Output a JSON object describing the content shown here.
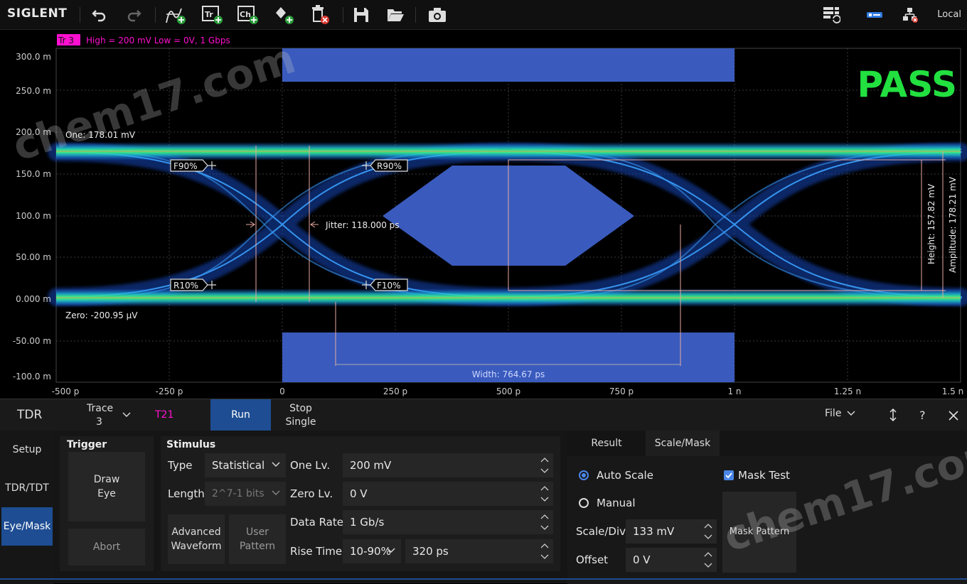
{
  "toolbar": {
    "logo": "SIGLENT",
    "local": "Local",
    "icons": [
      "undo-icon",
      "redo-icon",
      "add-math-icon",
      "add-trace-icon",
      "add-channel-icon",
      "add-marker-icon",
      "delete-icon",
      "save-icon",
      "open-folder-icon",
      "camera-icon",
      "layout-icon",
      "usb-icon",
      "network-icon"
    ]
  },
  "scope": {
    "trace_tag": "Tr 3",
    "trace_info": "High = 200 mV  Low = 0V, 1 Gbps",
    "pass_text": "PASS",
    "y_ticks": [
      "300.0 m",
      "250.0 m",
      "200.0 m",
      "150.0 m",
      "100.0 m",
      "50.00 m",
      "0.000 m",
      "-50.00 m",
      "-100.0 m"
    ],
    "x_ticks": [
      "-500 p",
      "-250 p",
      "0",
      "250 p",
      "500 p",
      "750 p",
      "1 n",
      "1.25 n",
      "1.5 n"
    ],
    "one_label": "One: 178.01 mV",
    "zero_label": "Zero: -200.95 µV",
    "jitter_label": "Jitter: 118.000 ps",
    "width_label": "Width: 764.67 ps",
    "height_label": "Height: 157.82 mV",
    "amplitude_label": "Amplitude: 178.21 mV",
    "markers": {
      "f90": "F90%",
      "r90": "R90%",
      "r10": "R10%",
      "f10": "F10%"
    }
  },
  "panel": {
    "title": "TDR",
    "trace_label": "Trace",
    "trace_value": "3",
    "t21": "T21",
    "run": "Run",
    "stop": "Stop",
    "single": "Single",
    "file": "File",
    "help": "?",
    "sidebar": [
      "Setup",
      "TDR/TDT",
      "Eye/Mask"
    ],
    "trigger": {
      "title": "Trigger",
      "draw": "Draw",
      "eye": "Eye",
      "abort": "Abort"
    },
    "stimulus": {
      "title": "Stimulus",
      "type_label": "Type",
      "type_value": "Statistical",
      "length_label": "Length",
      "length_value": "2^7-1 bits",
      "advanced": "Advanced",
      "waveform": "Waveform",
      "user": "User",
      "pattern": "Pattern",
      "one_label": "One Lv.",
      "one_value": "200 mV",
      "zero_label": "Zero Lv.",
      "zero_value": "0 V",
      "rate_label": "Data Rate",
      "rate_value": "1 Gb/s",
      "rise_label": "Rise Time",
      "rise_mode": "10-90%",
      "rise_value": "320 ps"
    },
    "right": {
      "tab_result": "Result",
      "tab_scale": "Scale/Mask",
      "auto": "Auto Scale",
      "manual": "Manual",
      "scale_label": "Scale/Div",
      "scale_value": "133 mV",
      "offset_label": "Offset",
      "offset_value": "0 V",
      "mask_test": "Mask Test",
      "mask_pattern": "Mask Pattern"
    }
  },
  "watermark": "chem17.com",
  "colors": {
    "pass": "#22e040",
    "trace_tag": "#ff10d0",
    "mask": "#3a5bbd",
    "active": "#1e4d93"
  }
}
